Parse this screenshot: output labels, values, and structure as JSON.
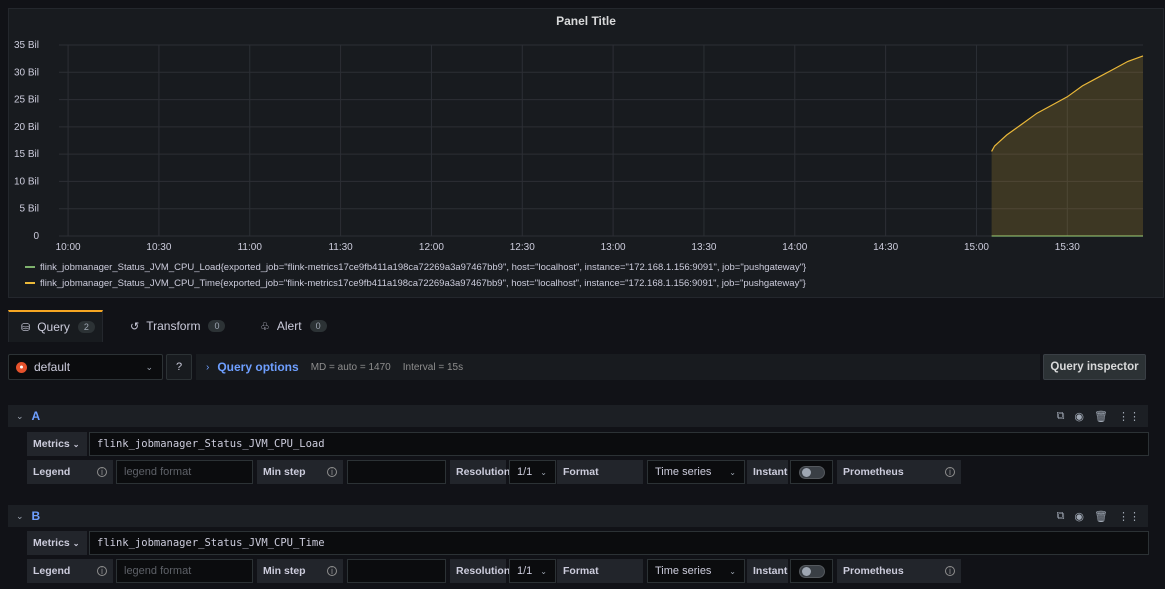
{
  "panel": {
    "title": "Panel Title"
  },
  "chart_data": {
    "type": "area",
    "y_ticks": [
      "35 Bil",
      "30 Bil",
      "25 Bil",
      "20 Bil",
      "15 Bil",
      "10 Bil",
      "5 Bil",
      "0"
    ],
    "x_ticks": [
      "10:00",
      "10:30",
      "11:00",
      "11:30",
      "12:00",
      "12:30",
      "13:00",
      "13:30",
      "14:00",
      "14:30",
      "15:00",
      "15:30"
    ],
    "ylim": [
      0,
      35000000000
    ],
    "xlim": [
      "09:57",
      "15:55"
    ],
    "grid": true,
    "legend_position": "bottom",
    "series": [
      {
        "name": "flink_jobmanager_Status_JVM_CPU_Load{exported_job=\"flink-metrics17ce9fb411a198ca72269a3a97467bb9\", host=\"localhost\", instance=\"172.168.1.156:9091\", job=\"pushgateway\"}",
        "color": "#7eb26d",
        "points": [
          [
            "15:05",
            0
          ],
          [
            "15:55",
            0
          ]
        ]
      },
      {
        "name": "flink_jobmanager_Status_JVM_CPU_Time{exported_job=\"flink-metrics17ce9fb411a198ca72269a3a97467bb9\", host=\"localhost\", instance=\"172.168.1.156:9091\", job=\"pushgateway\"}",
        "color": "#eab839",
        "points": [
          [
            "15:05",
            15500000000
          ],
          [
            "15:06",
            16500000000
          ],
          [
            "15:07",
            17000000000
          ],
          [
            "15:10",
            18500000000
          ],
          [
            "15:15",
            20500000000
          ],
          [
            "15:20",
            22500000000
          ],
          [
            "15:25",
            24000000000
          ],
          [
            "15:30",
            25500000000
          ],
          [
            "15:35",
            27500000000
          ],
          [
            "15:40",
            29000000000
          ],
          [
            "15:45",
            30500000000
          ],
          [
            "15:50",
            32000000000
          ],
          [
            "15:55",
            33000000000
          ]
        ]
      }
    ]
  },
  "tabs": [
    {
      "label": "Query",
      "count": "2",
      "icon": "database-icon"
    },
    {
      "label": "Transform",
      "count": "0",
      "icon": "transform-icon"
    },
    {
      "label": "Alert",
      "count": "0",
      "icon": "bell-icon"
    }
  ],
  "datasource": {
    "name": "default"
  },
  "query_options": {
    "label": "Query options",
    "md": "MD = auto = 1470",
    "interval": "Interval = 15s"
  },
  "inspector": {
    "label": "Query inspector"
  },
  "queries": [
    {
      "ref": "A",
      "metrics_label": "Metrics",
      "expr": "flink_jobmanager_Status_JVM_CPU_Load",
      "legend_label": "Legend",
      "legend_placeholder": "legend format",
      "minstep_label": "Min step",
      "resolution_label": "Resolution",
      "resolution": "1/1",
      "format_label": "Format",
      "format": "Time series",
      "instant_label": "Instant",
      "prometheus_label": "Prometheus"
    },
    {
      "ref": "B",
      "metrics_label": "Metrics",
      "expr": "flink_jobmanager_Status_JVM_CPU_Time",
      "legend_label": "Legend",
      "legend_placeholder": "legend format",
      "minstep_label": "Min step",
      "resolution_label": "Resolution",
      "resolution": "1/1",
      "format_label": "Format",
      "format": "Time series",
      "instant_label": "Instant",
      "prometheus_label": "Prometheus"
    }
  ]
}
